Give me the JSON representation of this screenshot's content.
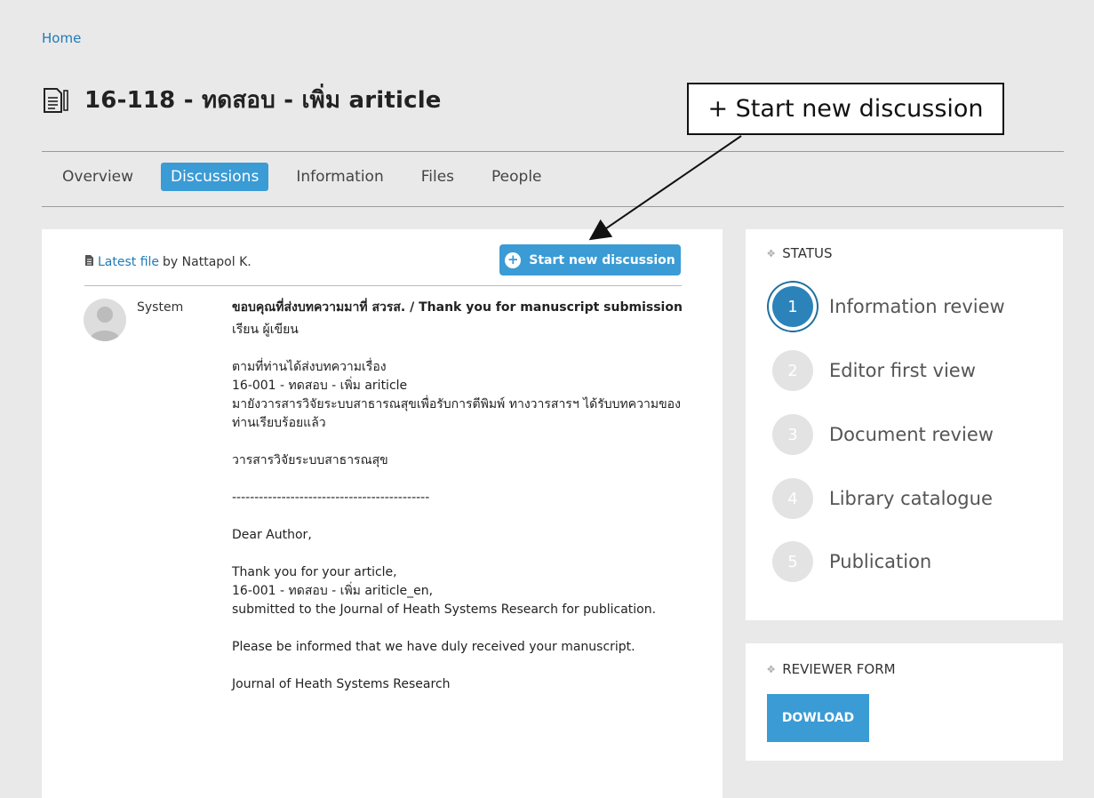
{
  "breadcrumb": {
    "home": "Home"
  },
  "page": {
    "title": "16-118 - ทดสอบ - เพิ่ม ariticle"
  },
  "tabs": [
    {
      "label": "Overview",
      "active": false
    },
    {
      "label": "Discussions",
      "active": true
    },
    {
      "label": "Information",
      "active": false
    },
    {
      "label": "Files",
      "active": false
    },
    {
      "label": "People",
      "active": false
    }
  ],
  "file_info": {
    "link_label": "Latest file",
    "by_text": "by Nattapol K."
  },
  "toolbar": {
    "start_discussion_label": "Start new discussion"
  },
  "discussion": {
    "author": "System",
    "subject": "ขอบคุณที่ส่งบทความมาที่ สวรส. / Thank you for manuscript submission",
    "body": [
      "เรียน ผู้เขียน",
      "ตามที่ท่านได้ส่งบทความเรื่อง\n16-001 - ทดสอบ - เพิ่ม ariticle\nมายังวารสารวิจัยระบบสาธารณสุขเพื่อรับการตีพิมพ์ ทางวารสารฯ ได้รับบทความของท่านเรียบร้อยแล้ว",
      "วารสารวิจัยระบบสาธารณสุข",
      "--------------------------------------------",
      "Dear Author,",
      "Thank you for your article,\n16-001 - ทดสอบ - เพิ่ม ariticle_en,\nsubmitted to the Journal of Heath Systems Research for publication.",
      "Please be informed that we have duly received your manuscript.",
      "Journal of Heath Systems Research"
    ]
  },
  "status": {
    "heading": "STATUS",
    "steps": [
      {
        "number": "1",
        "label": "Information review",
        "active": true
      },
      {
        "number": "2",
        "label": "Editor first view",
        "active": false
      },
      {
        "number": "3",
        "label": "Document review",
        "active": false
      },
      {
        "number": "4",
        "label": "Library catalogue",
        "active": false
      },
      {
        "number": "5",
        "label": "Publication",
        "active": false
      }
    ]
  },
  "reviewer_form": {
    "heading": "REVIEWER FORM",
    "download_label": "DOWLOAD"
  },
  "callout": {
    "text": "+ Start new discussion"
  },
  "colors": {
    "accent": "#3a9bd5",
    "active_step": "#2b83ba",
    "link": "#1f7bb6"
  }
}
